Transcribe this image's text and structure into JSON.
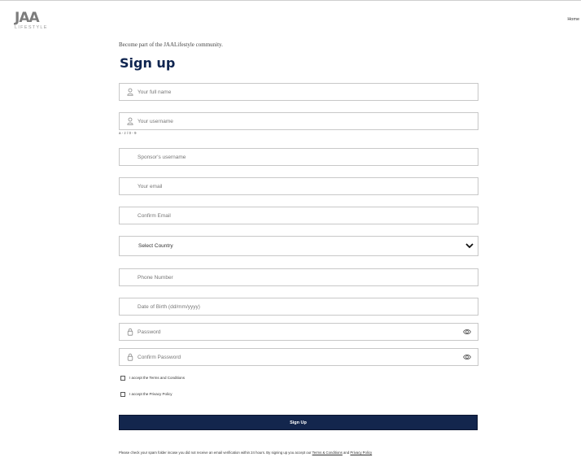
{
  "header": {
    "logo_mark": "JAA",
    "logo_sub": "LIFESTYLE",
    "nav_home": "Home"
  },
  "form": {
    "intro": "Become part of the JAALifestyle community.",
    "title": "Sign up",
    "fullname_placeholder": "Your full name",
    "username_placeholder": "Your username",
    "username_hint": "a - z / 0 - 9",
    "sponsor_placeholder": "Sponsor's username",
    "email_placeholder": "Your email",
    "confirm_email_placeholder": "Confirm Email",
    "country_selected": "Select Country",
    "phone_placeholder": "Phone Number",
    "dob_placeholder": "Date of Birth (dd/mm/yyyy)",
    "password_placeholder": "Password",
    "confirm_password_placeholder": "Confirm Password",
    "terms_label": "I accept the Terms and Conditions",
    "privacy_label": "I accept the Privacy Policy",
    "submit_label": "Sign Up"
  },
  "footer": {
    "note": "Please check your spam folder incase you did not receive an email verification within 24 hours. By signing up you accept our ",
    "terms_link": "Terms & Conditions",
    "and": " and ",
    "privacy_link": "Privacy Policy"
  },
  "colors": {
    "brand_navy": "#13264d",
    "title_navy": "#0f2550",
    "border": "#c8c8c8"
  },
  "icons": {
    "user": "user-icon",
    "lock": "lock-icon",
    "eye": "eye-icon",
    "chevron": "chevron-down-icon"
  }
}
